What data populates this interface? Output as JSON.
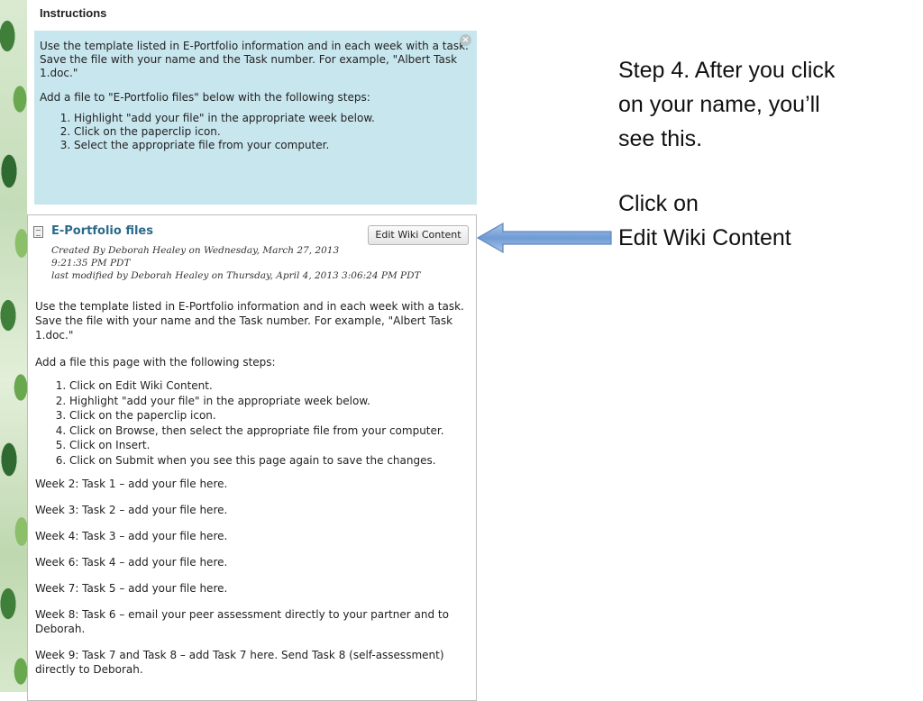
{
  "instructions": {
    "title": "Instructions",
    "paragraph1": "Use the template listed in E-Portfolio information and in each week with a task. Save the file with your name and the Task number. For example, \"Albert Task 1.doc.\"",
    "paragraph2": "Add a file to \"E-Portfolio files\" below with the following steps:",
    "steps": [
      "Highlight \"add your file\" in the appropriate week below.",
      "Click on the paperclip icon.",
      "Select the appropriate file from your computer."
    ],
    "close_symbol": "×"
  },
  "wiki": {
    "title": "E-Portfolio files",
    "edit_button": "Edit Wiki Content",
    "created_by": "Created By Deborah Healey on Wednesday, March 27, 2013",
    "created_time": "9:21:35 PM PDT",
    "modified": "last modified by Deborah Healey on Thursday, April 4, 2013 3:06:24 PM PDT",
    "paragraph1": "Use the template listed in E-Portfolio information and in each week with a task. Save the file with your name and the Task number. For example, \"Albert Task 1.doc.\"",
    "paragraph2": "Add a file this page with the following steps:",
    "steps": [
      "Click on Edit Wiki Content.",
      "Highlight \"add your file\" in the appropriate week below.",
      "Click on the paperclip icon.",
      "Click on Browse, then select the appropriate file from your computer.",
      "Click on Insert.",
      "Click on Submit when you see this page again to save the changes."
    ],
    "weeks": [
      "Week 2: Task 1 – add your file here.",
      "Week 3: Task 2 – add your file here.",
      "Week 4: Task 3 – add your file here.",
      "Week 6: Task 4 – add your file here.",
      "Week 7: Task 5 – add your file here.",
      "Week 8: Task 6 – email your peer assessment directly to your partner and to Deborah.",
      "Week 9: Task 7 and Task 8 – add Task 7 here. Send Task 8 (self-assessment) directly to Deborah."
    ]
  },
  "annotation": {
    "step_line1": "Step 4. After you click",
    "step_line2": "on your name, you’ll",
    "step_line3": "see this.",
    "click_line1": "Click on",
    "click_line2": "Edit Wiki Content"
  },
  "colors": {
    "instructions_bg": "#c8e6ee",
    "title_link": "#2a6a8a",
    "arrow_fill": "#7ea6d8"
  }
}
